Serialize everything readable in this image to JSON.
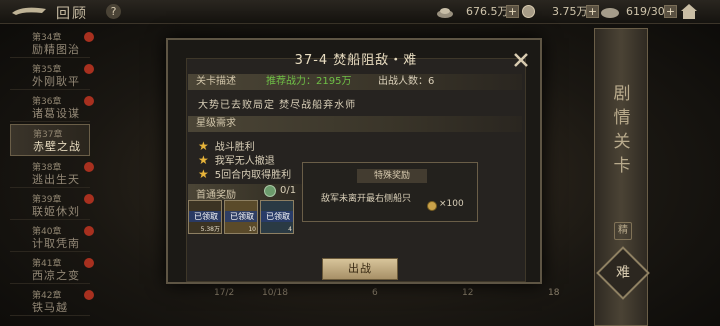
{
  "topbar": {
    "title": "回顾",
    "help": "?",
    "resource1": "676.5万",
    "resource2": "3.75万",
    "stamina": "619/300",
    "plus": "+"
  },
  "chapters": [
    {
      "num": "第34章",
      "name": "励精图治",
      "dot": true
    },
    {
      "num": "第35章",
      "name": "外刚耿平",
      "dot": true
    },
    {
      "num": "第36章",
      "name": "诸葛设谋",
      "dot": true
    },
    {
      "num": "第37章",
      "name": "赤壁之战",
      "dot": false,
      "active": true
    },
    {
      "num": "第38章",
      "name": "逃出生天",
      "dot": true
    },
    {
      "num": "第39章",
      "name": "联姬休刘",
      "dot": true
    },
    {
      "num": "第40章",
      "name": "计取凭南",
      "dot": true
    },
    {
      "num": "第41章",
      "name": "西凉之变",
      "dot": true
    },
    {
      "num": "第42章",
      "name": "铁马越",
      "dot": true
    }
  ],
  "side_scroll": {
    "title": "剧情关卡",
    "seal": "精",
    "difficulty": "难"
  },
  "strip": {
    "a": "17/2",
    "b": "10/18",
    "c": "6",
    "d": "12",
    "e": "18"
  },
  "modal": {
    "title": "37-4 焚船阻敌・难",
    "stage_desc_label": "关卡描述",
    "power": "推荐战力：2195万",
    "troops": "出战人数：6",
    "description": "大势已去败局定 焚尽战船弃水师",
    "star_req_label": "星级需求",
    "stars": [
      "战斗胜利",
      "我军无人撤退",
      "5回合内取得胜利"
    ],
    "normal_reward_label": "首通奖励",
    "normal_reward_count": "0/1",
    "reward_items": [
      {
        "claimed": "已领取",
        "amount": "5.38万"
      },
      {
        "claimed": "已领取",
        "amount": "10"
      },
      {
        "claimed": "已领取",
        "amount": "4"
      }
    ],
    "battle_button": "出战"
  },
  "special": {
    "title": "特殊奖励",
    "text": "敌军未离开最右侧船只",
    "amount": "×100"
  },
  "colors": {
    "accent": "#e7b43a",
    "power_green": "#6fc046",
    "dot_red": "#a8301f"
  }
}
